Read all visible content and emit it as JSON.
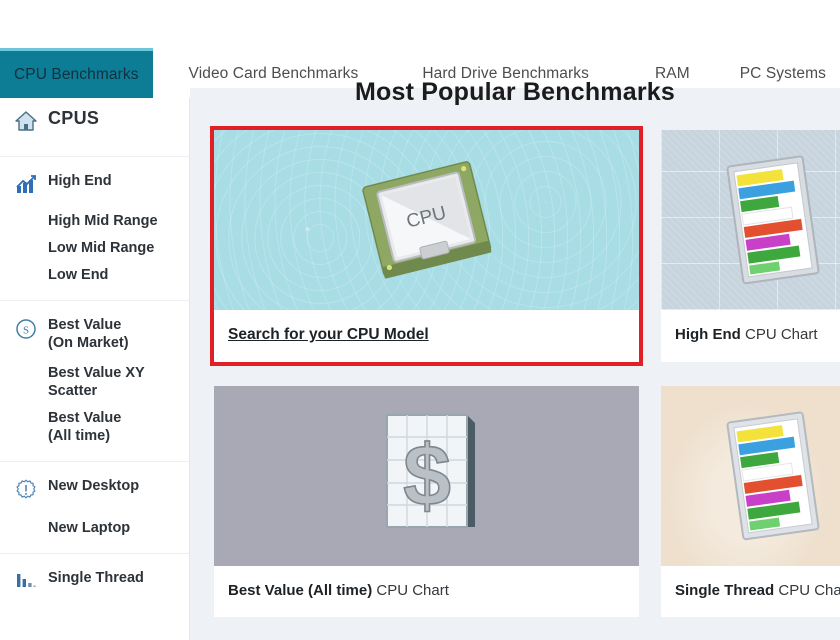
{
  "topnav": {
    "tabs": [
      {
        "label": "CPU Benchmarks",
        "active": true
      },
      {
        "label": "Video Card Benchmarks",
        "active": false
      },
      {
        "label": "Hard Drive Benchmarks",
        "active": false
      },
      {
        "label": "RAM",
        "active": false
      },
      {
        "label": "PC Systems",
        "active": false
      }
    ]
  },
  "sidebar": {
    "home": {
      "label": "CPUS",
      "icon": "home-icon"
    },
    "groups": [
      {
        "name": "high-end",
        "icon": "bar-chart-up-icon",
        "label": "High End",
        "sub": [
          "High Mid Range",
          "Low Mid Range",
          "Low End"
        ]
      },
      {
        "name": "best-value",
        "icon": "dollar-circle-icon",
        "label": "Best Value\n(On Market)",
        "label_line1": "Best Value",
        "label_line2": "(On Market)",
        "sub": [
          "Best Value XY Scatter",
          "Best Value (All time)"
        ]
      },
      {
        "name": "new-desktop",
        "icon": "burst-exclamation-icon",
        "label": "New Desktop",
        "sub": [
          "New Laptop"
        ]
      },
      {
        "name": "single-thread",
        "icon": "bar-chart-icon",
        "label": "Single Thread",
        "sub": []
      }
    ]
  },
  "main": {
    "title": "Most Popular Benchmarks",
    "cards": [
      {
        "name": "search-cpu-model",
        "caption_link": "Search for your CPU Model",
        "image": "cpu-chip-illustration",
        "highlighted": true,
        "bg": "#a9dde6"
      },
      {
        "name": "high-end-cpu-chart",
        "caption_bold": "High End",
        "caption_rest": " CPU Chart",
        "image": "colored-bar-chart-illustration",
        "highlighted": false,
        "bg": "#c7d4de"
      },
      {
        "name": "best-value-all-time-cpu-chart",
        "caption_bold": "Best Value (All time)",
        "caption_rest": " CPU Chart",
        "image": "dollar-sign-grid-illustration",
        "highlighted": false,
        "bg": "#a9a9b6"
      },
      {
        "name": "single-thread-cpu-chart",
        "caption_bold": "Single Thread",
        "caption_rest": " CPU Chart",
        "image": "colored-bar-chart-illustration",
        "highlighted": false,
        "bg": "#eee0cd"
      }
    ]
  },
  "colors": {
    "accent_teal": "#0d7c95",
    "highlight_red": "#e01f26",
    "content_bg": "#eef1f5",
    "icon_blue": "#2f6fb5"
  }
}
